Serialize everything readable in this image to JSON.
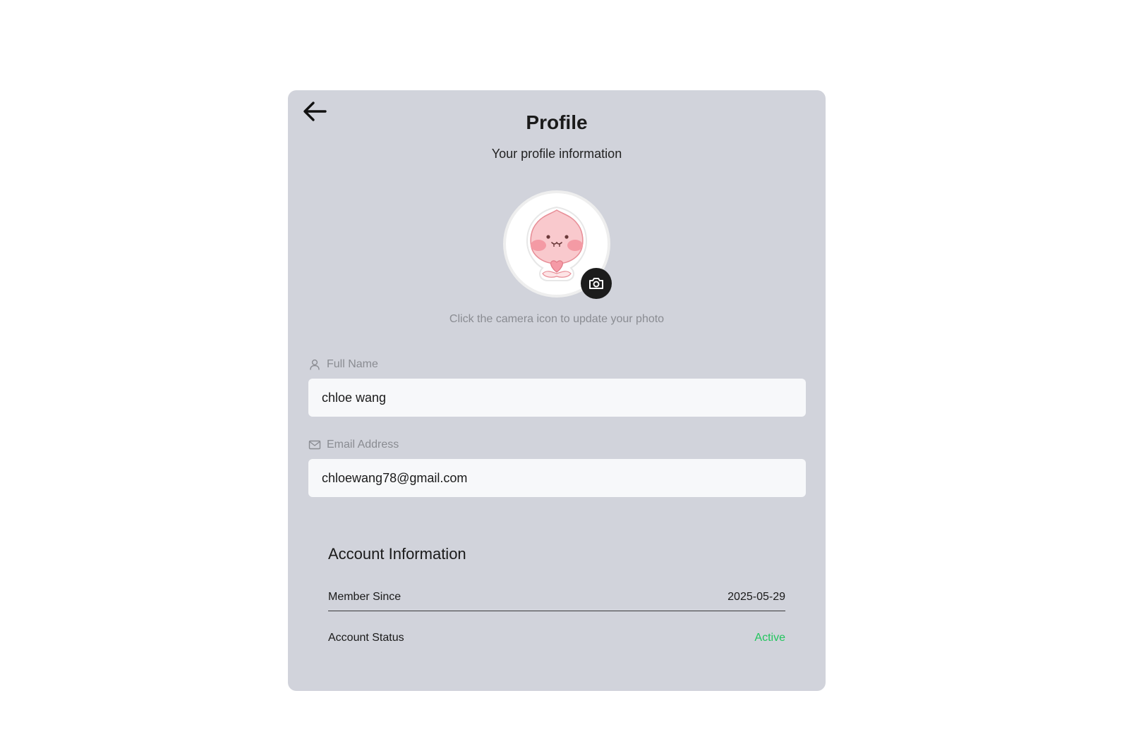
{
  "header": {
    "title": "Profile",
    "subtitle": "Your profile information"
  },
  "avatar": {
    "hint": "Click the camera icon to update your photo",
    "icon": "camera-icon"
  },
  "fields": {
    "full_name": {
      "label": "Full Name",
      "value": "chloe wang",
      "icon": "user-icon"
    },
    "email": {
      "label": "Email Address",
      "value": "chloewang78@gmail.com",
      "icon": "mail-icon"
    }
  },
  "account": {
    "title": "Account Information",
    "member_since_label": "Member Since",
    "member_since_value": "2025-05-29",
    "status_label": "Account Status",
    "status_value": "Active"
  },
  "colors": {
    "card_bg": "#d1d3db",
    "input_bg": "#f7f8fa",
    "status_active": "#22c55e",
    "camera_bg": "#1c1c1c"
  }
}
